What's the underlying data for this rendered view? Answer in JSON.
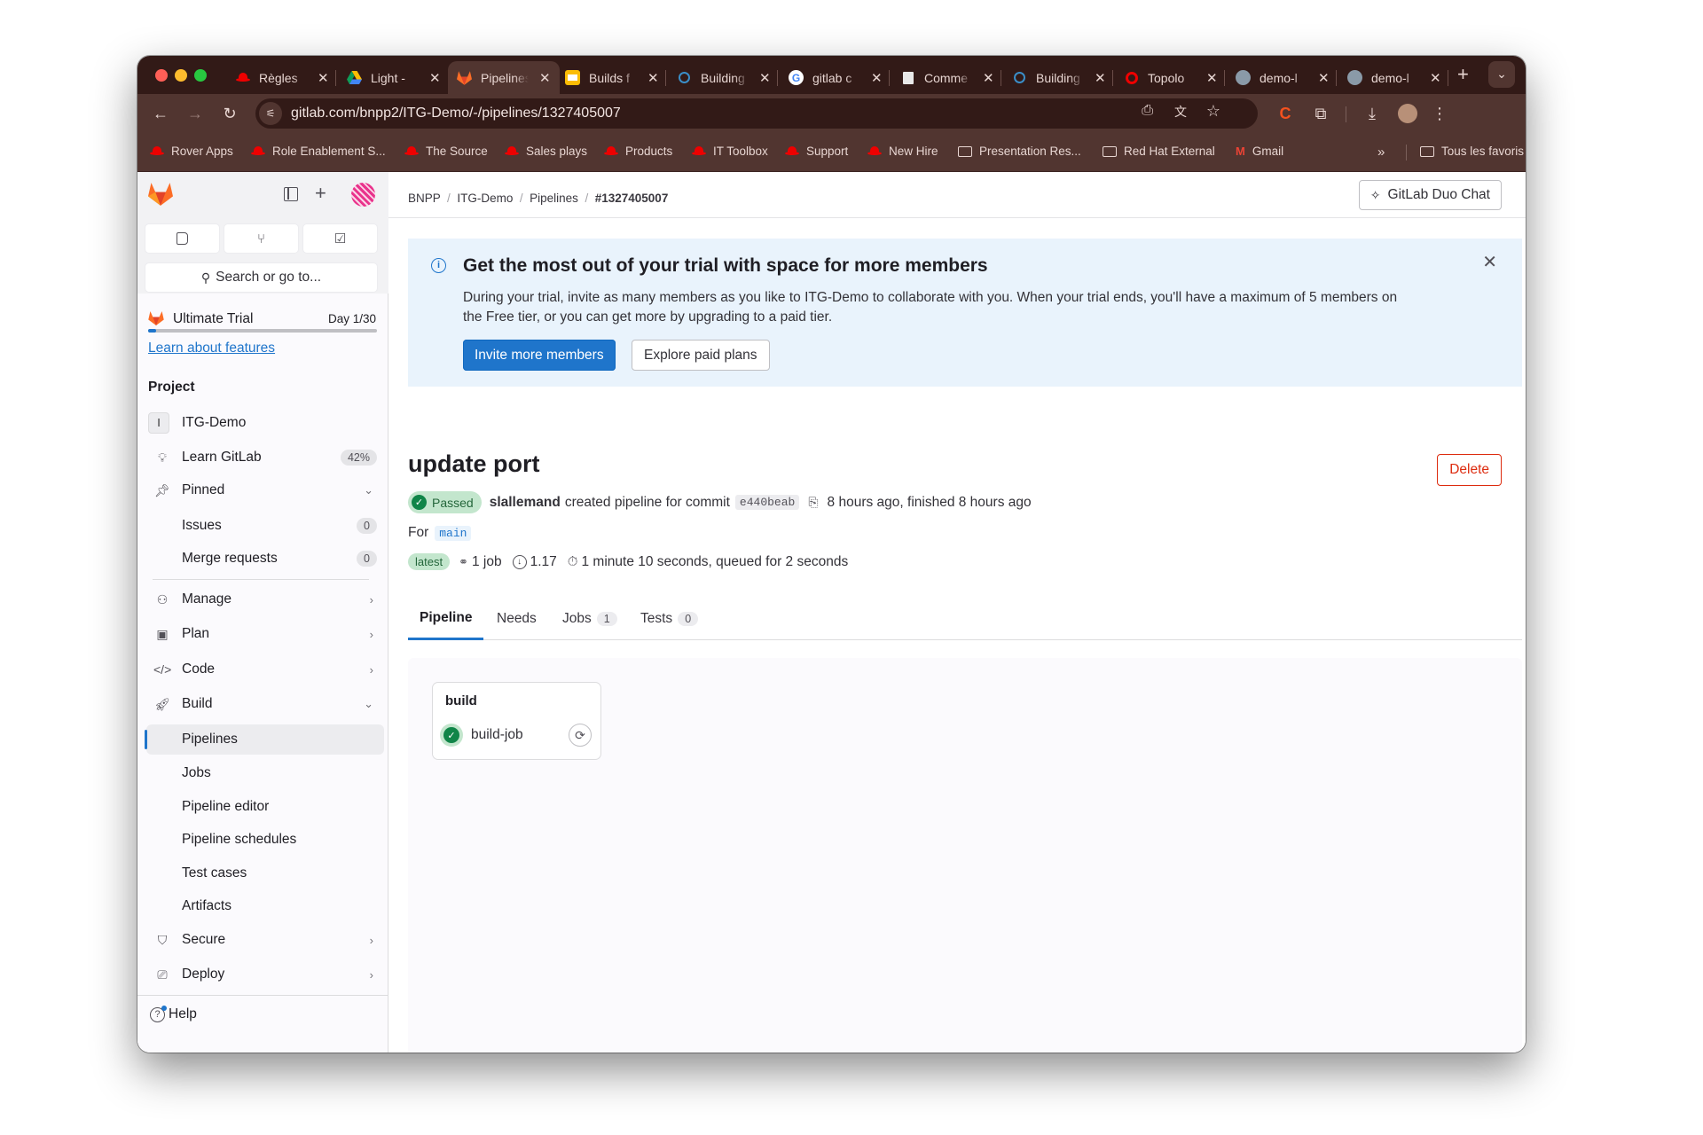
{
  "browser": {
    "tabs": [
      {
        "title": "Règles",
        "icon": "redhat-icon",
        "active": false
      },
      {
        "title": "Light -",
        "icon": "google-drive-icon",
        "active": false
      },
      {
        "title": "Pipelines",
        "icon": "gitlab-icon",
        "active": true
      },
      {
        "title": "Builds f",
        "icon": "google-slides-icon",
        "active": false
      },
      {
        "title": "Building",
        "icon": "ring-icon",
        "active": false
      },
      {
        "title": "gitlab c",
        "icon": "google-icon",
        "active": false
      },
      {
        "title": "Comme",
        "icon": "computer-icon",
        "active": false
      },
      {
        "title": "Building",
        "icon": "ring-icon",
        "active": false
      },
      {
        "title": "Topolo",
        "icon": "openshift-icon",
        "active": false
      },
      {
        "title": "demo-l",
        "icon": "globe-icon",
        "active": false
      },
      {
        "title": "demo-l",
        "icon": "globe-icon",
        "active": false
      }
    ],
    "new_tab": "+",
    "tab_search": "⌄",
    "url": "gitlab.com/bnpp2/ITG-Demo/-/pipelines/1327405007",
    "bookmarks": [
      {
        "label": "Rover Apps",
        "icon": "redhat-icon"
      },
      {
        "label": "Role Enablement S...",
        "icon": "redhat-icon"
      },
      {
        "label": "The Source",
        "icon": "redhat-icon"
      },
      {
        "label": "Sales plays",
        "icon": "redhat-icon"
      },
      {
        "label": "Products",
        "icon": "redhat-icon"
      },
      {
        "label": "IT Toolbox",
        "icon": "redhat-icon"
      },
      {
        "label": "Support",
        "icon": "redhat-icon"
      },
      {
        "label": "New Hire",
        "icon": "redhat-icon"
      },
      {
        "label": "Presentation Res...",
        "icon": "folder-icon"
      },
      {
        "label": "Red Hat External",
        "icon": "folder-icon"
      },
      {
        "label": "Gmail",
        "icon": "gmail-icon"
      }
    ],
    "bookmarks_overflow": "»",
    "all_bookmarks": "Tous les favoris"
  },
  "sidebar": {
    "search_placeholder": "Search or go to...",
    "trial": {
      "label": "Ultimate Trial",
      "day": "Day 1/30",
      "progress": 0.033
    },
    "learn_link": "Learn about features",
    "section_title": "Project",
    "project": {
      "initial": "I",
      "name": "ITG-Demo"
    },
    "learn_gitlab": {
      "label": "Learn GitLab",
      "badge": "42%"
    },
    "pinned": {
      "label": "Pinned",
      "items": [
        {
          "label": "Issues",
          "count": "0"
        },
        {
          "label": "Merge requests",
          "count": "0"
        }
      ]
    },
    "groups": [
      {
        "label": "Manage",
        "icon": "users-icon"
      },
      {
        "label": "Plan",
        "icon": "calendar-icon"
      },
      {
        "label": "Code",
        "icon": "code-icon"
      },
      {
        "label": "Build",
        "icon": "rocket-icon",
        "expanded": true
      }
    ],
    "build_items": [
      "Pipelines",
      "Jobs",
      "Pipeline editor",
      "Pipeline schedules",
      "Test cases",
      "Artifacts"
    ],
    "active_item": "Pipelines",
    "more_groups": [
      {
        "label": "Secure",
        "icon": "shield-icon"
      },
      {
        "label": "Deploy",
        "icon": "deploy-icon"
      }
    ],
    "help": "Help"
  },
  "breadcrumb": [
    "BNPP",
    "ITG-Demo",
    "Pipelines",
    "#1327405007"
  ],
  "duo_chat": "GitLab Duo Chat",
  "banner": {
    "title": "Get the most out of your trial with space for more members",
    "body_line1": "During your trial, invite as many members as you like to ITG-Demo to collaborate with you. When your trial ends, you'll have a maximum of 5 members on",
    "body_line2": "the Free tier, or you can get more by upgrading to a paid tier.",
    "primary": "Invite more members",
    "secondary": "Explore paid plans"
  },
  "pipeline": {
    "title": "update port",
    "delete": "Delete",
    "status": "Passed",
    "author": "slallemand",
    "created_text": "created pipeline for commit",
    "commit": "e440beab",
    "time_text": "8 hours ago, finished 8 hours ago",
    "for_label": "For",
    "branch": "main",
    "latest": "latest",
    "jobs": "1 job",
    "compute": "1.17",
    "duration": "1 minute 10 seconds, queued for 2 seconds"
  },
  "tabs": [
    {
      "label": "Pipeline",
      "count": null,
      "active": true
    },
    {
      "label": "Needs",
      "count": null
    },
    {
      "label": "Jobs",
      "count": "1"
    },
    {
      "label": "Tests",
      "count": "0"
    }
  ],
  "graph": {
    "stage": "build",
    "job": {
      "name": "build-job",
      "status": "success"
    }
  },
  "colors": {
    "accent": "#1f75cb",
    "success": "#108548",
    "danger": "#dd2b0e",
    "chrome_dark": "#321a17",
    "chrome_mid": "#513530"
  }
}
